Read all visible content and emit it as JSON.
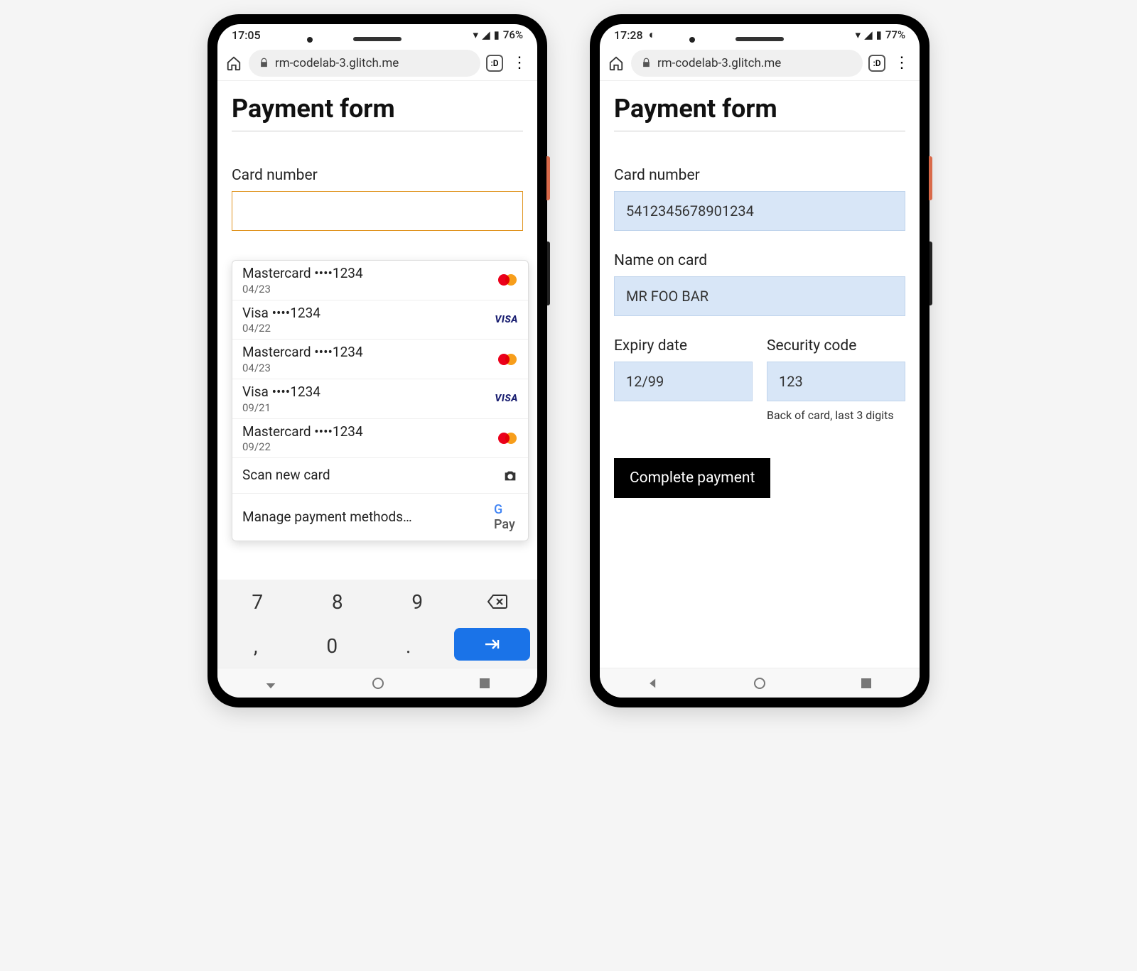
{
  "phone1": {
    "status": {
      "time": "17:05",
      "battery": "76%"
    },
    "url": "rm-codelab-3.glitch.me",
    "tabs_badge": ":D",
    "title": "Payment form",
    "card_number_label": "Card number",
    "autofill": {
      "cards": [
        {
          "brand": "Mastercard",
          "mask": "••••1234",
          "exp": "04/23",
          "type": "mc"
        },
        {
          "brand": "Visa",
          "mask": "••••1234",
          "exp": "04/22",
          "type": "visa"
        },
        {
          "brand": "Mastercard",
          "mask": "••••1234",
          "exp": "04/23",
          "type": "mc"
        },
        {
          "brand": "Visa",
          "mask": "••••1234",
          "exp": "09/21",
          "type": "visa"
        },
        {
          "brand": "Mastercard",
          "mask": "••••1234",
          "exp": "09/22",
          "type": "mc"
        }
      ],
      "scan_label": "Scan new card",
      "manage_label": "Manage payment methods…",
      "gpay_label": "Pay"
    },
    "keypad": {
      "row1": [
        "7",
        "8",
        "9",
        "⌫"
      ],
      "row2": [
        ",",
        "0",
        ".",
        "→|"
      ]
    }
  },
  "phone2": {
    "status": {
      "time": "17:28",
      "battery": "77%"
    },
    "url": "rm-codelab-3.glitch.me",
    "tabs_badge": ":D",
    "title": "Payment form",
    "fields": {
      "card_number": {
        "label": "Card number",
        "value": "5412345678901234"
      },
      "name": {
        "label": "Name on card",
        "value": "MR FOO BAR"
      },
      "expiry": {
        "label": "Expiry date",
        "value": "12/99"
      },
      "cvc": {
        "label": "Security code",
        "value": "123",
        "hint": "Back of card, last 3 digits"
      }
    },
    "submit": "Complete payment"
  }
}
